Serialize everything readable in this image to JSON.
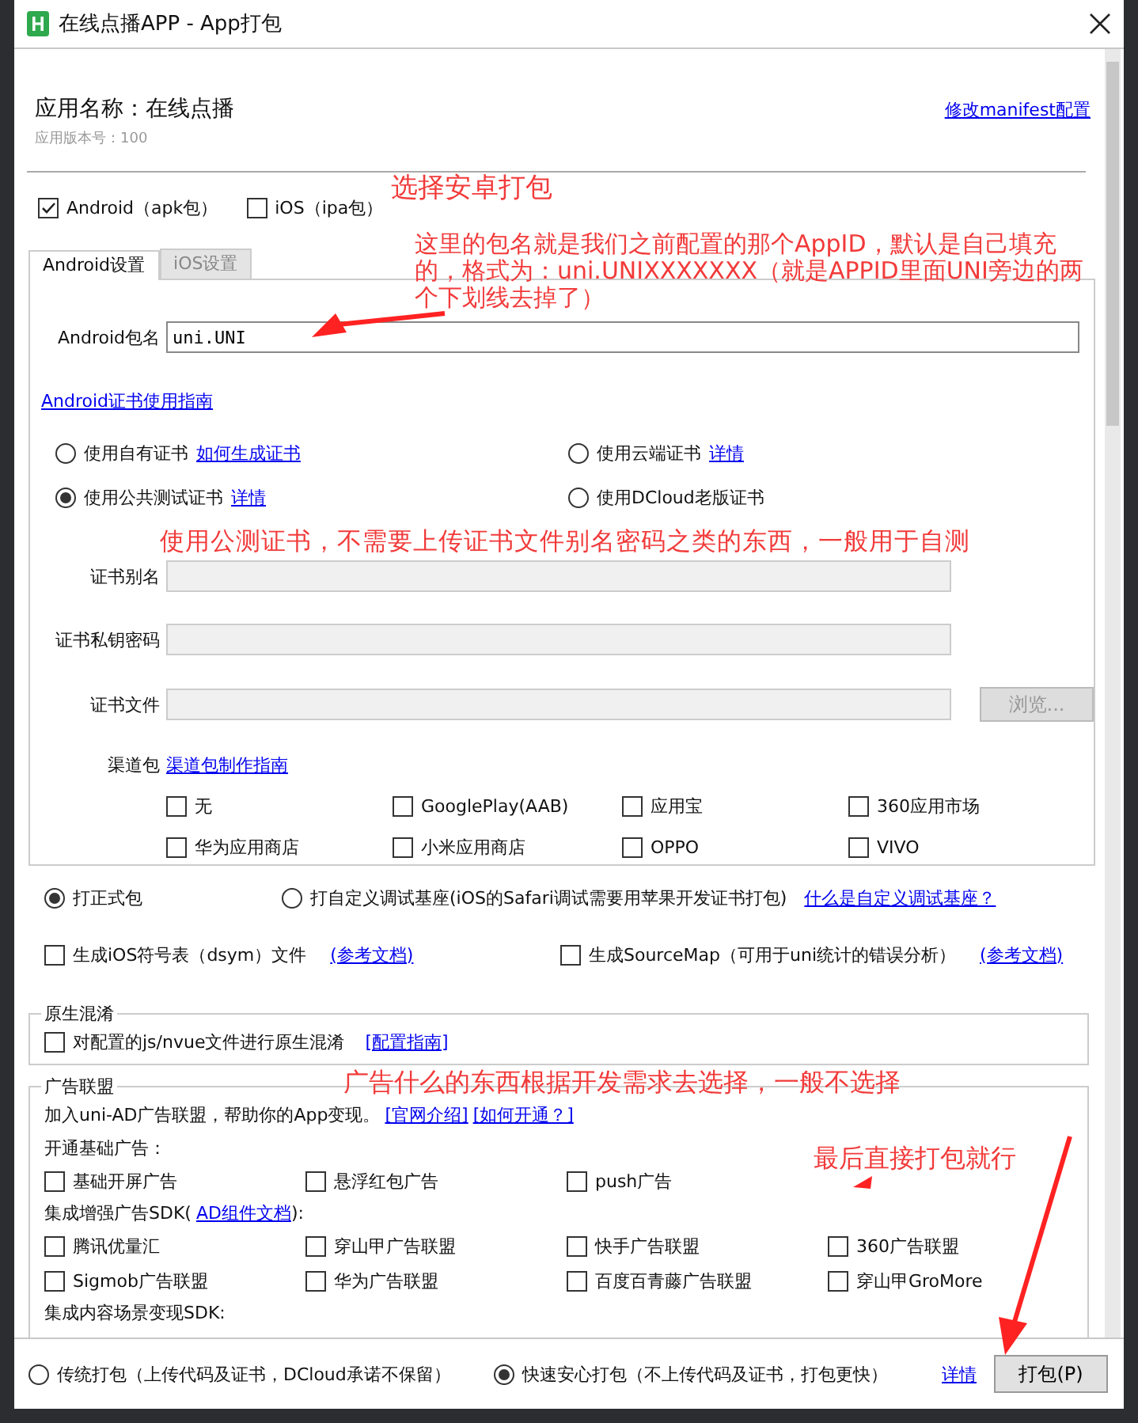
{
  "window": {
    "title": "在线点播APP - App打包"
  },
  "app": {
    "name": "应用名称：在线点播",
    "version": "应用版本号：100",
    "manifest_link": "修改manifest配置"
  },
  "platforms": [
    {
      "label": "Android（apk包）",
      "checked": true
    },
    {
      "label": "iOS（ipa包）",
      "checked": false
    }
  ],
  "tabs": [
    {
      "label": "Android设置",
      "selected": true
    },
    {
      "label": "iOS设置",
      "selected": false
    }
  ],
  "android": {
    "package_label": "Android包名",
    "package_value": "uni.UNI",
    "cert_guide": "Android证书使用指南",
    "cert_options": [
      {
        "label": "使用自有证书",
        "link": "如何生成证书",
        "selected": false
      },
      {
        "label": "使用云端证书",
        "link": "详情",
        "selected": false
      },
      {
        "label": "使用公共测试证书",
        "link": "详情",
        "selected": true
      },
      {
        "label": "使用DCloud老版证书",
        "selected": false
      }
    ],
    "cert_fields": [
      {
        "label": "证书别名",
        "disabled": true
      },
      {
        "label": "证书私钥密码",
        "disabled": true
      },
      {
        "label": "证书文件",
        "disabled": true,
        "button": "浏览..."
      }
    ],
    "channels": {
      "label": "渠道包",
      "link": "渠道包制作指南",
      "items": [
        {
          "label": "无",
          "checked": false
        },
        {
          "label": "GooglePlay(AAB)",
          "checked": false
        },
        {
          "label": "应用宝",
          "checked": false
        },
        {
          "label": "360应用市场",
          "checked": false
        },
        {
          "label": "华为应用商店",
          "checked": false
        },
        {
          "label": "小米应用商店",
          "checked": false
        },
        {
          "label": "OPPO",
          "checked": false
        },
        {
          "label": "VIVO",
          "checked": false
        }
      ]
    }
  },
  "build_types": [
    {
      "label": "打正式包",
      "selected": true
    },
    {
      "label": "打自定义调试基座(iOS的Safari调试需要用苹果开发证书打包)",
      "selected": false,
      "link": "什么是自定义调试基座？"
    }
  ],
  "extras": [
    {
      "label": "生成iOS符号表（dsym）文件",
      "checked": false,
      "link": "(参考文档)"
    },
    {
      "label": "生成SourceMap（可用于uni统计的错误分析）",
      "checked": false,
      "link": "(参考文档)"
    }
  ],
  "obfuscation": {
    "title": "原生混淆",
    "label": "对配置的js/nvue文件进行原生混淆",
    "checked": false,
    "link": "[配置指南]"
  },
  "ads": {
    "title": "广告联盟",
    "intro": "加入uni-AD广告联盟，帮助你的App变现。",
    "links": [
      "[官网介绍]",
      "[如何开通？]"
    ],
    "groups": [
      {
        "heading": "开通基础广告：",
        "items": [
          {
            "label": "基础开屏广告",
            "checked": false
          },
          {
            "label": "悬浮红包广告",
            "checked": false
          },
          {
            "label": "push广告",
            "checked": false
          }
        ]
      },
      {
        "heading": "集成增强广告SDK(",
        "heading_link": "AD组件文档",
        "heading_end": "):",
        "items": [
          {
            "label": "腾讯优量汇",
            "checked": false
          },
          {
            "label": "穿山甲广告联盟",
            "checked": false
          },
          {
            "label": "快手广告联盟",
            "checked": false
          },
          {
            "label": "360广告联盟",
            "checked": false
          },
          {
            "label": "Sigmob广告联盟",
            "checked": false
          },
          {
            "label": "华为广告联盟",
            "checked": false
          },
          {
            "label": "百度百青藤广告联盟",
            "checked": false
          },
          {
            "label": "穿山甲GroMore",
            "checked": false
          }
        ]
      },
      {
        "heading": "集成内容场景变现SDK:"
      }
    ]
  },
  "packaging": {
    "options": [
      {
        "label": "传统打包（上传代码及证书，DCloud承诺不保留）",
        "selected": false
      },
      {
        "label": "快速安心打包（不上传代码及证书，打包更快）",
        "selected": true
      }
    ],
    "link": "详情",
    "button": "打包(P)"
  },
  "annotations": [
    "选择安卓打包",
    "这里的包名就是我们之前配置的那个AppID，默认是自己填充的，格式为：uni.UNIXXXXXXX（就是APPID里面UNI旁边的两个下划线去掉了）",
    "使用公测证书，不需要上传证书文件别名密码之类的东西，一般用于自测",
    "广告什么的东西根据开发需求去选择，一般不选择",
    "最后直接打包就行"
  ]
}
